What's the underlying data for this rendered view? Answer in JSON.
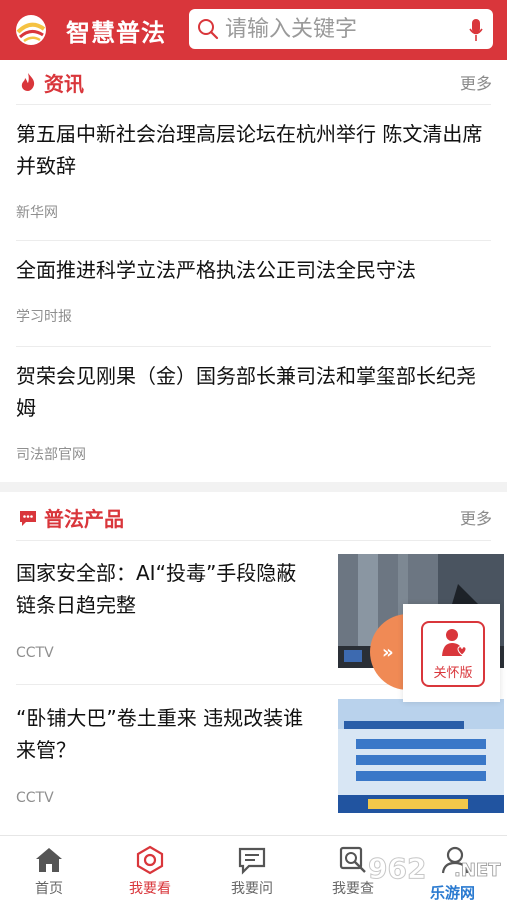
{
  "header": {
    "app_title": "智慧普法",
    "search_placeholder": "请输入关键字",
    "brand_color": "#d9363b"
  },
  "news_section": {
    "title": "资讯",
    "more": "更多",
    "items": [
      {
        "title": "第五届中新社会治理高层论坛在杭州举行 陈文清出席并致辞",
        "source": "新华网"
      },
      {
        "title": "全面推进科学立法严格执法公正司法全民守法",
        "source": "学习时报"
      },
      {
        "title": "贺荣会见刚果（金）国务部长兼司法和掌玺部长纪尧姆",
        "source": "司法部官网"
      }
    ]
  },
  "product_section": {
    "title": "普法产品",
    "more": "更多",
    "items": [
      {
        "title": "国家安全部：AI“投毒”手段隐蔽 链条日趋完整",
        "source": "CCTV"
      },
      {
        "title": "“卧铺大巴”卷土重来 违规改装谁来管？",
        "source": "CCTV"
      }
    ]
  },
  "care_widget": {
    "label": "关怀版"
  },
  "bottom_nav": {
    "items": [
      {
        "label": "首页",
        "icon": "home-icon",
        "active": false
      },
      {
        "label": "我要看",
        "icon": "watch-icon",
        "active": true
      },
      {
        "label": "我要问",
        "icon": "chat-icon",
        "active": false
      },
      {
        "label": "我要查",
        "icon": "search-icon",
        "active": false
      },
      {
        "label": "",
        "icon": "profile-icon",
        "active": false
      }
    ]
  },
  "watermark": {
    "text_top": "962",
    "text_net": ".NET",
    "text_bottom": "乐游网"
  }
}
